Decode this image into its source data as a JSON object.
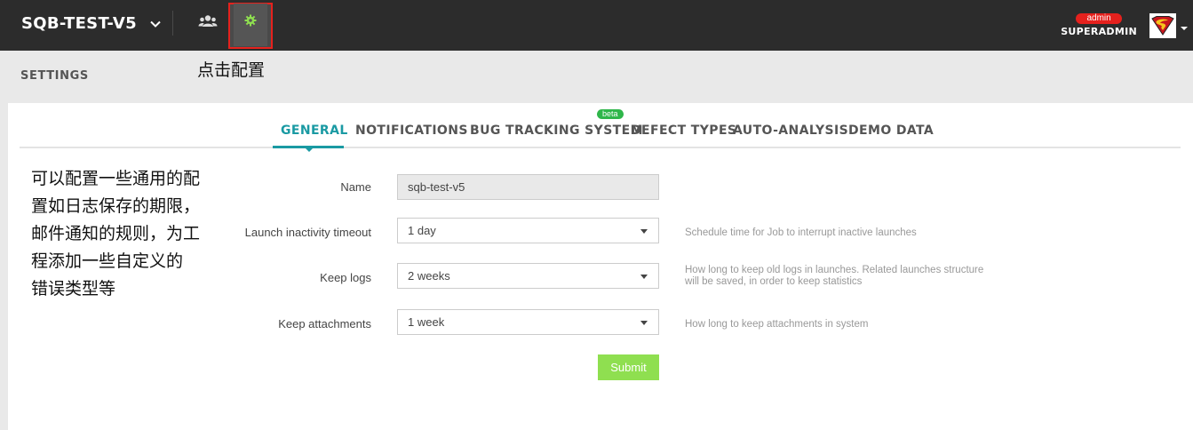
{
  "header": {
    "project_name": "SQB-TEST-V5",
    "user_role_badge": "admin",
    "username": "SUPERADMIN"
  },
  "annotations": {
    "click_config": "点击配置",
    "description_lines": [
      "可以配置一些通用的配",
      "置如日志保存的期限，",
      "邮件通知的规则，为工",
      "程添加一些自定义的",
      "错误类型等"
    ]
  },
  "page": {
    "title": "SETTINGS"
  },
  "tabs": [
    {
      "label": "GENERAL",
      "active": true
    },
    {
      "label": "NOTIFICATIONS"
    },
    {
      "label": "BUG TRACKING SYSTEM",
      "badge": "beta"
    },
    {
      "label": "DEFECT TYPES"
    },
    {
      "label": "AUTO-ANALYSIS"
    },
    {
      "label": "DEMO DATA"
    }
  ],
  "form": {
    "name": {
      "label": "Name",
      "value": "sqb-test-v5"
    },
    "launch_timeout": {
      "label": "Launch inactivity timeout",
      "value": "1 day",
      "hint": "Schedule time for Job to interrupt inactive launches"
    },
    "keep_logs": {
      "label": "Keep logs",
      "value": "2 weeks",
      "hint_line1": "How long to keep old logs in launches. Related launches structure",
      "hint_line2": "will be saved, in order to keep statistics"
    },
    "keep_attachments": {
      "label": "Keep attachments",
      "value": "1 week",
      "hint": "How long to keep attachments in system"
    },
    "submit_label": "Submit"
  },
  "colors": {
    "accent": "#1a9aa3",
    "topbar": "#2c2c2c",
    "submit": "#8fdf50",
    "badge": "#e5211d",
    "beta": "#2fb64a"
  }
}
